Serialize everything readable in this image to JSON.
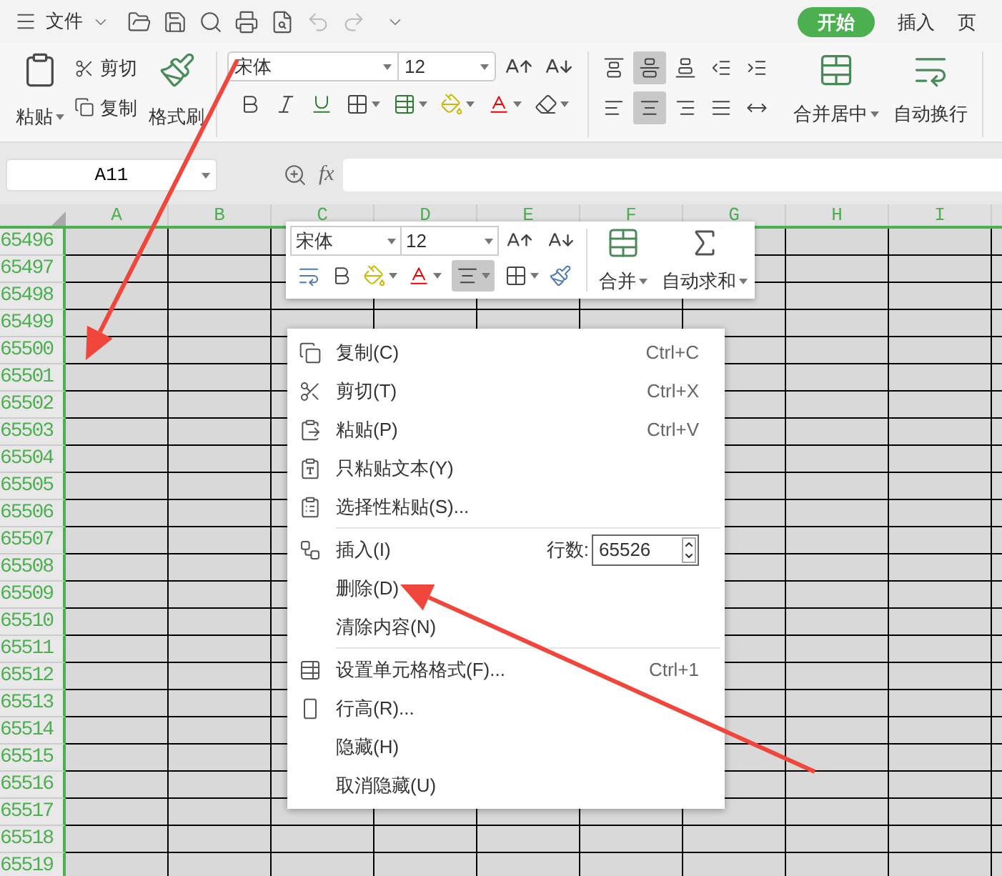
{
  "title_bar": {
    "menu_label": "文件",
    "tabs": [
      {
        "label": "开始",
        "selected": true
      },
      {
        "label": "插入",
        "selected": false
      },
      {
        "label": "页",
        "selected": false
      }
    ]
  },
  "ribbon": {
    "paste": "粘贴",
    "cut": "剪切",
    "copy": "复制",
    "format_painter": "格式刷",
    "font": "宋体",
    "font_size": "12",
    "merge": "合并居中",
    "wrap": "自动换行",
    "alignment": [
      {
        "selected": false
      },
      {
        "selected": true
      },
      {
        "selected": false
      },
      {
        "selected": false
      },
      {
        "selected": false
      },
      {
        "selected": false
      },
      {
        "selected": true
      },
      {
        "selected": false
      },
      {
        "selected": false
      },
      {
        "selected": false
      }
    ]
  },
  "formula_bar": {
    "cell_ref": "A11",
    "fx": "fx"
  },
  "sheet": {
    "columns": [
      "A",
      "B",
      "C",
      "D",
      "E",
      "F",
      "G",
      "H",
      "I"
    ],
    "rows": [
      "65496",
      "65497",
      "65498",
      "65499",
      "65500",
      "65501",
      "65502",
      "65503",
      "65504",
      "65505",
      "65506",
      "65507",
      "65508",
      "65509",
      "65510",
      "65511",
      "65512",
      "65513",
      "65514",
      "65515",
      "65516",
      "65517",
      "65518",
      "65519"
    ]
  },
  "mini_toolbar": {
    "font": "宋体",
    "font_size": "12",
    "align_selected": true,
    "merge": "合并",
    "autosum": "自动求和"
  },
  "context_menu": {
    "items": [
      {
        "kind": "item",
        "label": "复制(C)",
        "shortcut": "Ctrl+C",
        "separator_before": false
      },
      {
        "kind": "item",
        "label": "剪切(T)",
        "shortcut": "Ctrl+X",
        "separator_before": false
      },
      {
        "kind": "item",
        "label": "粘贴(P)",
        "shortcut": "Ctrl+V",
        "separator_before": false
      },
      {
        "kind": "item",
        "label": "只粘贴文本(Y)",
        "separator_before": false
      },
      {
        "kind": "item",
        "label": "选择性粘贴(S)...",
        "separator_before": false
      },
      {
        "kind": "count",
        "label": "插入(I)",
        "count_label": "行数:",
        "count": "65526",
        "separator_before": true
      },
      {
        "kind": "item",
        "label": "删除(D)",
        "separator_before": false
      },
      {
        "kind": "item",
        "label": "清除内容(N)",
        "separator_before": false
      },
      {
        "kind": "item",
        "label": "设置单元格格式(F)...",
        "shortcut": "Ctrl+1",
        "separator_before": true
      },
      {
        "kind": "item",
        "label": "行高(R)...",
        "separator_before": false
      },
      {
        "kind": "item",
        "label": "隐藏(H)",
        "separator_before": false
      },
      {
        "kind": "item",
        "label": "取消隐藏(U)",
        "separator_before": false
      }
    ]
  }
}
